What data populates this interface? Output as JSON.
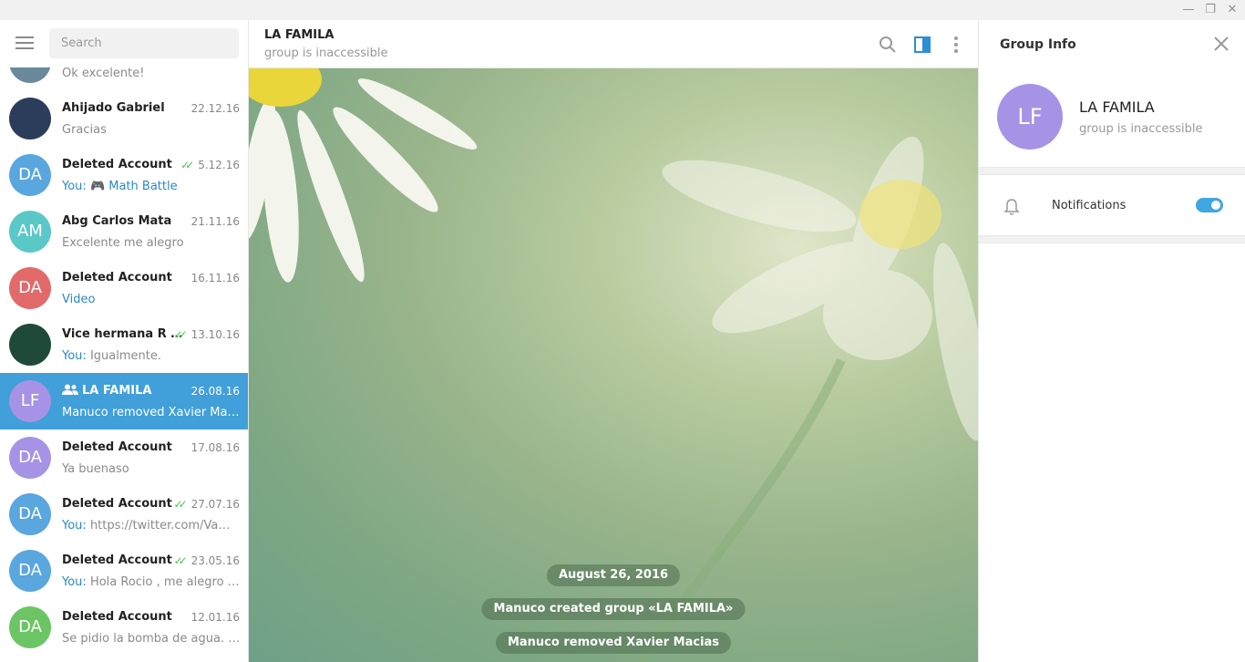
{
  "window": {
    "minimize": "—",
    "restore": "❐",
    "close": "✕"
  },
  "left": {
    "search_placeholder": "Search",
    "dialogs": [
      {
        "initials": "",
        "avatar_color": "#6a8a9c",
        "name": "",
        "date": "",
        "you": "",
        "msg": "Ok excelente!",
        "msg_blue": false,
        "checks": false,
        "group": false,
        "active": false
      },
      {
        "initials": "",
        "avatar_color": "#2b3d5a",
        "name": "Ahijado Gabriel",
        "date": "22.12.16",
        "you": "",
        "msg": "Gracias",
        "msg_blue": false,
        "checks": false,
        "group": false,
        "active": false
      },
      {
        "initials": "DA",
        "avatar_color": "#5aa6df",
        "name": "Deleted Account",
        "date": "5.12.16",
        "you": "You:",
        "msg": "🎮 Math Battle",
        "msg_blue": true,
        "checks": true,
        "group": false,
        "active": false
      },
      {
        "initials": "AM",
        "avatar_color": "#5bc8c8",
        "name": "Abg Carlos Mata",
        "date": "21.11.16",
        "you": "",
        "msg": "Excelente me alegro",
        "msg_blue": false,
        "checks": false,
        "group": false,
        "active": false
      },
      {
        "initials": "DA",
        "avatar_color": "#e26a6a",
        "name": "Deleted Account",
        "date": "16.11.16",
        "you": "",
        "msg": "Video",
        "msg_blue": true,
        "checks": false,
        "group": false,
        "active": false
      },
      {
        "initials": "",
        "avatar_color": "#1f4a3a",
        "name": "Vice hermana R G...",
        "date": "13.10.16",
        "you": "You:",
        "msg": "Igualmente.",
        "msg_blue": false,
        "checks": true,
        "group": false,
        "active": false
      },
      {
        "initials": "LF",
        "avatar_color": "#a793e5",
        "name": "LA FAMILA",
        "date": "26.08.16",
        "you": "",
        "msg": "Manuco removed Xavier Macias",
        "msg_blue": false,
        "checks": false,
        "group": true,
        "active": true
      },
      {
        "initials": "DA",
        "avatar_color": "#a793e5",
        "name": "Deleted Account",
        "date": "17.08.16",
        "you": "",
        "msg": "Ya buenaso",
        "msg_blue": false,
        "checks": false,
        "group": false,
        "active": false
      },
      {
        "initials": "DA",
        "avatar_color": "#5aa6df",
        "name": "Deleted Account",
        "date": "27.07.16",
        "you": "You:",
        "msg": "https://twitter.com/Vamo...",
        "msg_blue": false,
        "checks": true,
        "group": false,
        "active": false
      },
      {
        "initials": "DA",
        "avatar_color": "#5aa6df",
        "name": "Deleted Account",
        "date": "23.05.16",
        "you": "You:",
        "msg": "Hola Rocio , me alegro q la...",
        "msg_blue": false,
        "checks": true,
        "group": false,
        "active": false
      },
      {
        "initials": "DA",
        "avatar_color": "#6cc565",
        "name": "Deleted Account",
        "date": "12.01.16",
        "you": "",
        "msg": "Se pidio la bomba de agua. Deb...",
        "msg_blue": false,
        "checks": false,
        "group": false,
        "active": false
      }
    ]
  },
  "chat": {
    "title": "LA FAMILA",
    "subtitle": "group is inaccessible",
    "service_messages": [
      "August 26, 2016",
      "Manuco created group «LA FAMILA»",
      "Manuco removed Xavier Macias"
    ]
  },
  "info": {
    "panel_title": "Group Info",
    "initials": "LF",
    "name": "LA FAMILA",
    "subtitle": "group is inaccessible",
    "notifications_label": "Notifications",
    "notifications_on": true
  },
  "colors": {
    "accent": "#419fd9",
    "toggle": "#40a7e3"
  }
}
